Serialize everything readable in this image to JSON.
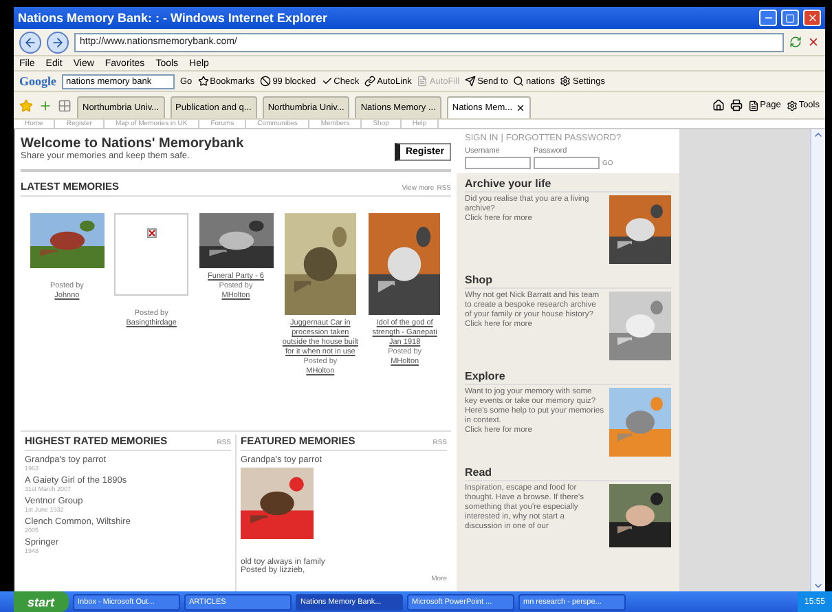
{
  "window": {
    "title": "Nations Memory Bank: : - Windows Internet Explorer"
  },
  "address_bar": {
    "url": "http://www.nationsmemorybank.com/"
  },
  "menu": [
    "File",
    "Edit",
    "View",
    "Favorites",
    "Tools",
    "Help"
  ],
  "google_toolbar": {
    "logo": "Google",
    "search": "nations memory bank",
    "items": [
      {
        "label": "Go",
        "disabled": false
      },
      {
        "label": "Bookmarks",
        "disabled": false
      },
      {
        "label": "99 blocked",
        "disabled": false
      },
      {
        "label": "Check",
        "disabled": false
      },
      {
        "label": "AutoLink",
        "disabled": false
      },
      {
        "label": "AutoFill",
        "disabled": true
      },
      {
        "label": "Send to",
        "disabled": false
      },
      {
        "label": "nations",
        "disabled": false
      },
      {
        "label": "Settings",
        "disabled": false
      }
    ]
  },
  "tabs": [
    {
      "label": "Northumbria Univ...",
      "selected": false
    },
    {
      "label": "Publication and q...",
      "selected": false
    },
    {
      "label": "Northumbria Univ...",
      "selected": false
    },
    {
      "label": "Nations Memory ...",
      "selected": false
    },
    {
      "label": "Nations Mem...",
      "selected": true
    }
  ],
  "tab_tools": [
    "Page",
    "Tools"
  ],
  "site_nav": [
    "Home",
    "Register",
    "Map of Memories in UK",
    "Forums",
    "Communities",
    "Members",
    "Shop",
    "Help"
  ],
  "welcome": {
    "title": "Welcome to Nations' Memorybank",
    "subtitle": "Share your memories and keep them safe.",
    "button": "Register"
  },
  "latest": {
    "title": "LATEST MEMORIES",
    "view_more": "View more",
    "rss": "RSS",
    "items": [
      {
        "kind": "picture",
        "posted": "Posted by",
        "user": "Johnno"
      },
      {
        "kind": "broken",
        "posted": "Posted by",
        "user": "Basingthirdage"
      },
      {
        "kind": "picture",
        "caption": "Funeral Party - 6",
        "posted": "Posted by",
        "user": "MHolton"
      },
      {
        "kind": "tall",
        "caption": "Juggernaut Car in procession taken outside the house built for it when not in use",
        "posted": "Posted by",
        "user": "MHolton"
      },
      {
        "kind": "tall",
        "caption": "Idol of the god of strength - Ganepati Jan 1918",
        "posted": "Posted by",
        "user": "MHolton"
      }
    ]
  },
  "highest": {
    "title": "HIGHEST RATED MEMORIES",
    "rss": "RSS",
    "items": [
      {
        "title": "Grandpa's toy parrot",
        "date": "1963"
      },
      {
        "title": "A Gaiety Girl of the 1890s",
        "date": "31st March 2007"
      },
      {
        "title": "Ventnor Group",
        "date": "1st June 1932"
      },
      {
        "title": "Clench Common, Wiltshire",
        "date": "2005"
      },
      {
        "title": "Springer",
        "date": "1948"
      }
    ]
  },
  "featured": {
    "title": "FEATURED MEMORIES",
    "rss": "RSS",
    "item_title": "Grandpa's toy parrot",
    "description": "old toy always in family",
    "posted": "Posted by lizzieb,",
    "more": "More"
  },
  "signin": {
    "sign_in": "SIGN IN",
    "separator": "|",
    "forgot": "FORGOTTEN PASSWORD?",
    "username": "Username",
    "password": "Password",
    "go": "GO"
  },
  "promos": [
    {
      "title": "Archive your life",
      "text": "Did you realise that you are a living archive?",
      "link": "Click here for more"
    },
    {
      "title": "Shop",
      "text": "Why not get Nick Barratt and his team to create a bespoke research archive of your family or your house history?",
      "link": "Click here for more"
    },
    {
      "title": "Explore",
      "text": "Want to jog your memory with some key events or take our memory quiz? Here's some help to put your memories in context.",
      "link": "Click here for more"
    },
    {
      "title": "Read",
      "text": "Inspiration, escape and food for thought. Have a browse. If there's something that you're especially interested in, why not start a discussion in one of our"
    }
  ],
  "taskbar": {
    "start": "start",
    "tasks": [
      {
        "label": "Inbox - Microsoft Out...",
        "selected": false
      },
      {
        "label": "ARTICLES",
        "selected": false
      },
      {
        "label": "Nations Memory Bank...",
        "selected": true
      },
      {
        "label": "Microsoft PowerPoint ...",
        "selected": false
      },
      {
        "label": "mn research - perspe...",
        "selected": false
      }
    ],
    "clock": "15:55"
  }
}
